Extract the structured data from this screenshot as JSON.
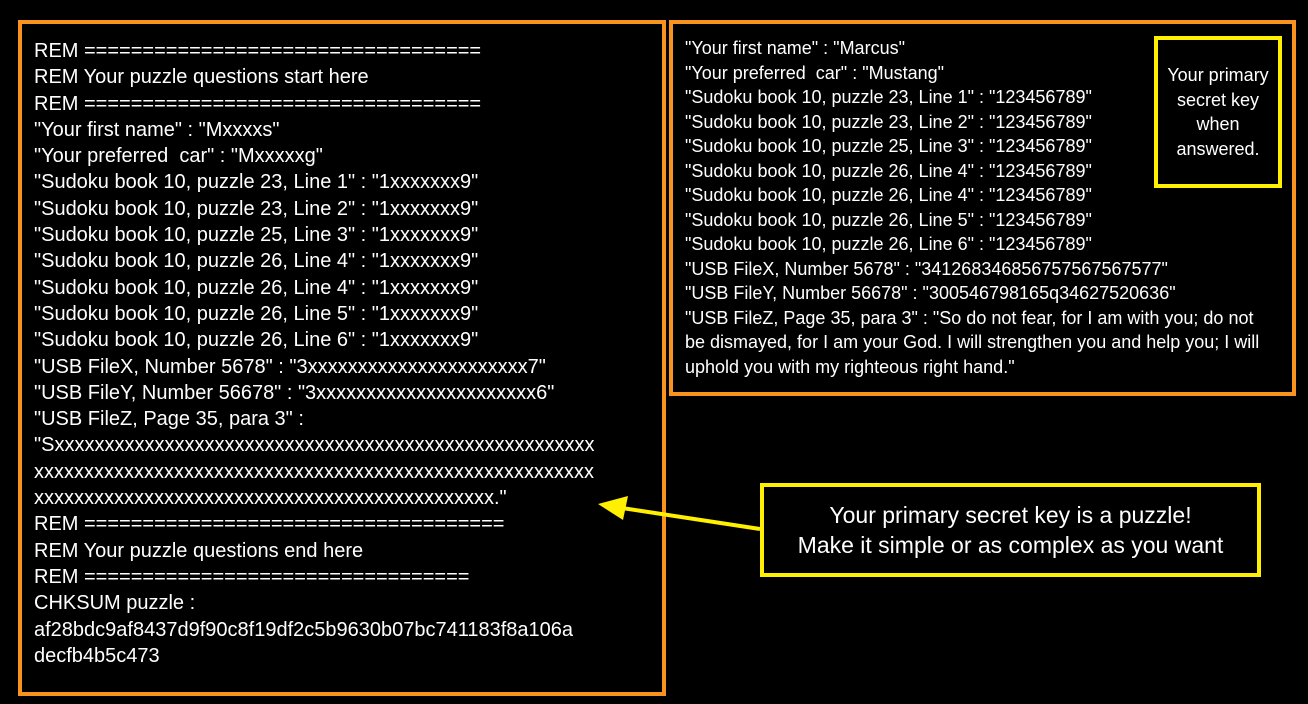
{
  "left_panel": {
    "lines": [
      "REM ==================================",
      "REM Your puzzle questions start here",
      "REM ==================================",
      "\"Your first name\" : \"Mxxxxs\"",
      "\"Your preferred  car\" : \"Mxxxxxg\"",
      "\"Sudoku book 10, puzzle 23, Line 1\" : \"1xxxxxxx9\"",
      "\"Sudoku book 10, puzzle 23, Line 2\" : \"1xxxxxxx9\"",
      "\"Sudoku book 10, puzzle 25, Line 3\" : \"1xxxxxxx9\"",
      "\"Sudoku book 10, puzzle 26, Line 4\" : \"1xxxxxxx9\"",
      "\"Sudoku book 10, puzzle 26, Line 4\" : \"1xxxxxxx9\"",
      "\"Sudoku book 10, puzzle 26, Line 5\" : \"1xxxxxxx9\"",
      "\"Sudoku book 10, puzzle 26, Line 6\" : \"1xxxxxxx9\"",
      "\"USB FileX, Number 5678\" : \"3xxxxxxxxxxxxxxxxxxxxxx7\"",
      "\"USB FileY, Number 56678\" : \"3xxxxxxxxxxxxxxxxxxxxxx6\"",
      "\"USB FileZ, Page 35, para 3\" :"
    ],
    "long_value_lines": [
      "\"Sxxxxxxxxxxxxxxxxxxxxxxxxxxxxxxxxxxxxxxxxxxxxxxxxxxxxxx",
      "xxxxxxxxxxxxxxxxxxxxxxxxxxxxxxxxxxxxxxxxxxxxxxxxxxxxxxxx",
      "xxxxxxxxxxxxxxxxxxxxxxxxxxxxxxxxxxxxxxxxxxxxxx.\""
    ],
    "end_lines": [
      "REM ====================================",
      "REM Your puzzle questions end here",
      "REM =================================",
      "CHKSUM puzzle :"
    ],
    "checksum_lines": [
      "af28bdc9af8437d9f90c8f19df2c5b9630b07bc741183f8a106a",
      "decfb4b5c473"
    ]
  },
  "right_panel": {
    "lines": [
      "\"Your first name\" : \"Marcus\"",
      "\"Your preferred  car\" : \"Mustang\"",
      "\"Sudoku book 10, puzzle 23, Line 1\" : \"123456789\"",
      "\"Sudoku book 10, puzzle 23, Line 2\" : \"123456789\"",
      "\"Sudoku book 10, puzzle 25, Line 3\" : \"123456789\"",
      "\"Sudoku book 10, puzzle 26, Line 4\" : \"123456789\"",
      "\"Sudoku book 10, puzzle 26, Line 4\" : \"123456789\"",
      "\"Sudoku book 10, puzzle 26, Line 5\" : \"123456789\"",
      "\"Sudoku book 10, puzzle 26, Line 6\" : \"123456789\"",
      "\"USB FileX, Number 5678\" : \"341268346856757567567577\"",
      "\"USB FileY, Number 56678\" : \"300546798165q34627520636\""
    ],
    "quote": "\"USB FileZ, Page 35, para 3\" : \"So do not fear, for I am with you; do not be dismayed, for I am your God. I will strengthen you and help you; I will uphold you with my righteous right hand.\""
  },
  "key_box": {
    "text": "Your primary secret key when answered."
  },
  "callout": {
    "line1": "Your primary secret key is a puzzle!",
    "line2": "Make it simple or as complex as you want"
  },
  "colors": {
    "background": "#000000",
    "panel_border": "#f7931e",
    "highlight_border": "#ffef00",
    "text": "#ffffff"
  }
}
